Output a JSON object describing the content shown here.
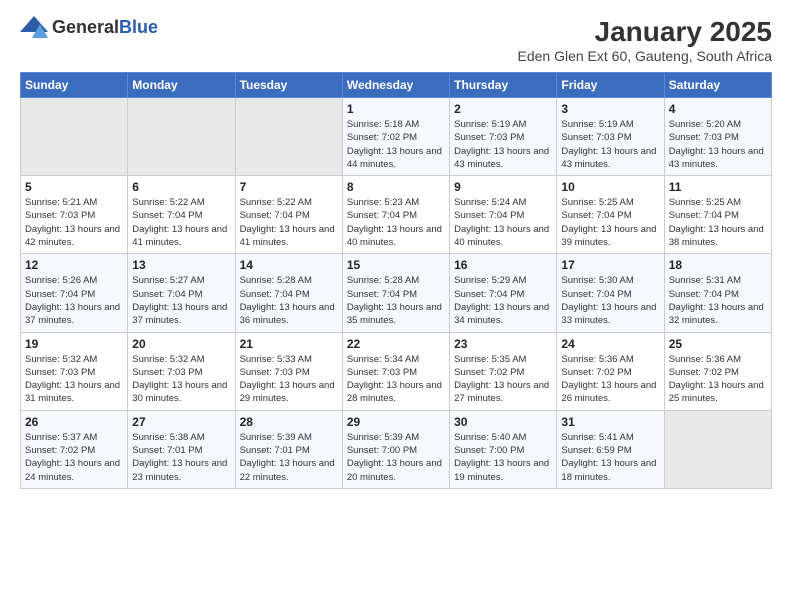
{
  "logo": {
    "general": "General",
    "blue": "Blue"
  },
  "title": "January 2025",
  "location": "Eden Glen Ext 60, Gauteng, South Africa",
  "weekdays": [
    "Sunday",
    "Monday",
    "Tuesday",
    "Wednesday",
    "Thursday",
    "Friday",
    "Saturday"
  ],
  "weeks": [
    [
      {
        "day": "",
        "empty": true
      },
      {
        "day": "",
        "empty": true
      },
      {
        "day": "",
        "empty": true
      },
      {
        "day": "1",
        "sunrise": "5:18 AM",
        "sunset": "7:02 PM",
        "daylight": "13 hours and 44 minutes."
      },
      {
        "day": "2",
        "sunrise": "5:19 AM",
        "sunset": "7:03 PM",
        "daylight": "13 hours and 43 minutes."
      },
      {
        "day": "3",
        "sunrise": "5:19 AM",
        "sunset": "7:03 PM",
        "daylight": "13 hours and 43 minutes."
      },
      {
        "day": "4",
        "sunrise": "5:20 AM",
        "sunset": "7:03 PM",
        "daylight": "13 hours and 43 minutes."
      }
    ],
    [
      {
        "day": "5",
        "sunrise": "5:21 AM",
        "sunset": "7:03 PM",
        "daylight": "13 hours and 42 minutes."
      },
      {
        "day": "6",
        "sunrise": "5:22 AM",
        "sunset": "7:04 PM",
        "daylight": "13 hours and 41 minutes."
      },
      {
        "day": "7",
        "sunrise": "5:22 AM",
        "sunset": "7:04 PM",
        "daylight": "13 hours and 41 minutes."
      },
      {
        "day": "8",
        "sunrise": "5:23 AM",
        "sunset": "7:04 PM",
        "daylight": "13 hours and 40 minutes."
      },
      {
        "day": "9",
        "sunrise": "5:24 AM",
        "sunset": "7:04 PM",
        "daylight": "13 hours and 40 minutes."
      },
      {
        "day": "10",
        "sunrise": "5:25 AM",
        "sunset": "7:04 PM",
        "daylight": "13 hours and 39 minutes."
      },
      {
        "day": "11",
        "sunrise": "5:25 AM",
        "sunset": "7:04 PM",
        "daylight": "13 hours and 38 minutes."
      }
    ],
    [
      {
        "day": "12",
        "sunrise": "5:26 AM",
        "sunset": "7:04 PM",
        "daylight": "13 hours and 37 minutes."
      },
      {
        "day": "13",
        "sunrise": "5:27 AM",
        "sunset": "7:04 PM",
        "daylight": "13 hours and 37 minutes."
      },
      {
        "day": "14",
        "sunrise": "5:28 AM",
        "sunset": "7:04 PM",
        "daylight": "13 hours and 36 minutes."
      },
      {
        "day": "15",
        "sunrise": "5:28 AM",
        "sunset": "7:04 PM",
        "daylight": "13 hours and 35 minutes."
      },
      {
        "day": "16",
        "sunrise": "5:29 AM",
        "sunset": "7:04 PM",
        "daylight": "13 hours and 34 minutes."
      },
      {
        "day": "17",
        "sunrise": "5:30 AM",
        "sunset": "7:04 PM",
        "daylight": "13 hours and 33 minutes."
      },
      {
        "day": "18",
        "sunrise": "5:31 AM",
        "sunset": "7:04 PM",
        "daylight": "13 hours and 32 minutes."
      }
    ],
    [
      {
        "day": "19",
        "sunrise": "5:32 AM",
        "sunset": "7:03 PM",
        "daylight": "13 hours and 31 minutes."
      },
      {
        "day": "20",
        "sunrise": "5:32 AM",
        "sunset": "7:03 PM",
        "daylight": "13 hours and 30 minutes."
      },
      {
        "day": "21",
        "sunrise": "5:33 AM",
        "sunset": "7:03 PM",
        "daylight": "13 hours and 29 minutes."
      },
      {
        "day": "22",
        "sunrise": "5:34 AM",
        "sunset": "7:03 PM",
        "daylight": "13 hours and 28 minutes."
      },
      {
        "day": "23",
        "sunrise": "5:35 AM",
        "sunset": "7:02 PM",
        "daylight": "13 hours and 27 minutes."
      },
      {
        "day": "24",
        "sunrise": "5:36 AM",
        "sunset": "7:02 PM",
        "daylight": "13 hours and 26 minutes."
      },
      {
        "day": "25",
        "sunrise": "5:36 AM",
        "sunset": "7:02 PM",
        "daylight": "13 hours and 25 minutes."
      }
    ],
    [
      {
        "day": "26",
        "sunrise": "5:37 AM",
        "sunset": "7:02 PM",
        "daylight": "13 hours and 24 minutes."
      },
      {
        "day": "27",
        "sunrise": "5:38 AM",
        "sunset": "7:01 PM",
        "daylight": "13 hours and 23 minutes."
      },
      {
        "day": "28",
        "sunrise": "5:39 AM",
        "sunset": "7:01 PM",
        "daylight": "13 hours and 22 minutes."
      },
      {
        "day": "29",
        "sunrise": "5:39 AM",
        "sunset": "7:00 PM",
        "daylight": "13 hours and 20 minutes."
      },
      {
        "day": "30",
        "sunrise": "5:40 AM",
        "sunset": "7:00 PM",
        "daylight": "13 hours and 19 minutes."
      },
      {
        "day": "31",
        "sunrise": "5:41 AM",
        "sunset": "6:59 PM",
        "daylight": "13 hours and 18 minutes."
      },
      {
        "day": "",
        "empty": true
      }
    ]
  ],
  "labels": {
    "sunrise": "Sunrise:",
    "sunset": "Sunset:",
    "daylight": "Daylight:"
  }
}
